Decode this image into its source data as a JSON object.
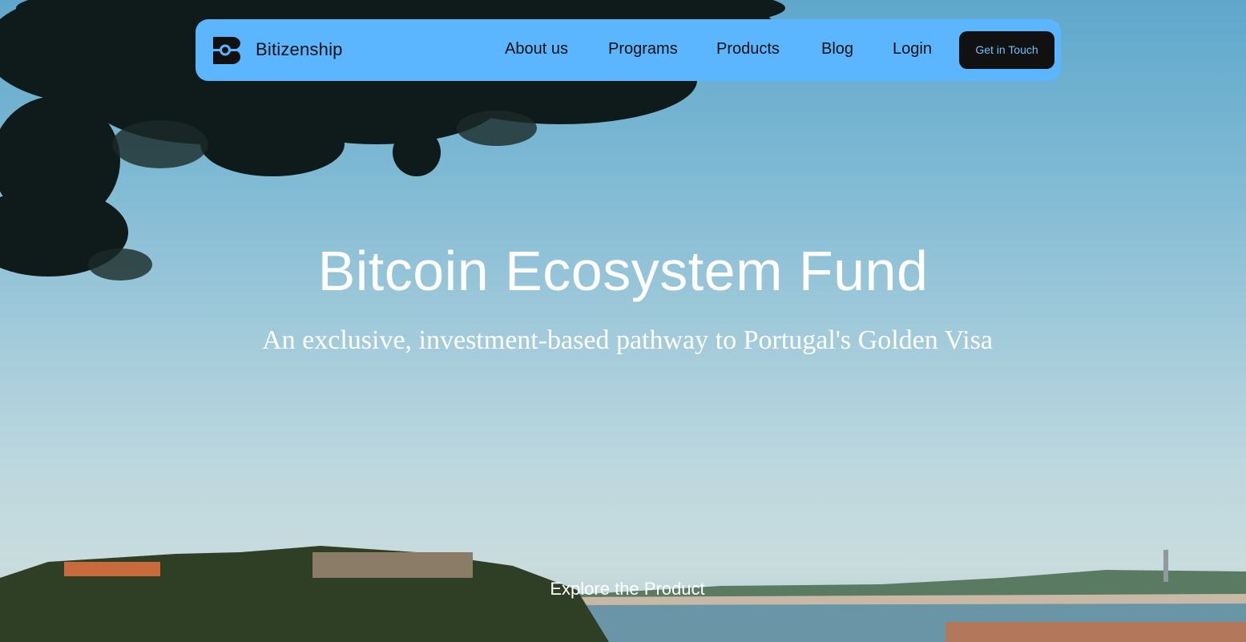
{
  "nav": {
    "brand": "Bitizenship",
    "links": [
      "About us",
      "Programs",
      "Products",
      "Blog",
      "Login"
    ],
    "cta_label": "Get in Touch"
  },
  "hero": {
    "title": "Bitcoin Ecosystem Fund",
    "subtitle": "An exclusive, investment-based pathway to Portugal's Golden Visa",
    "explore_label": "Explore the Product"
  },
  "colors": {
    "nav_background": "#5cb6ff",
    "cta_background": "#111111",
    "cta_text": "#6fc0ff",
    "hero_text": "#ffffff"
  },
  "icons": {
    "logo": "bitizenship-logo-icon"
  }
}
